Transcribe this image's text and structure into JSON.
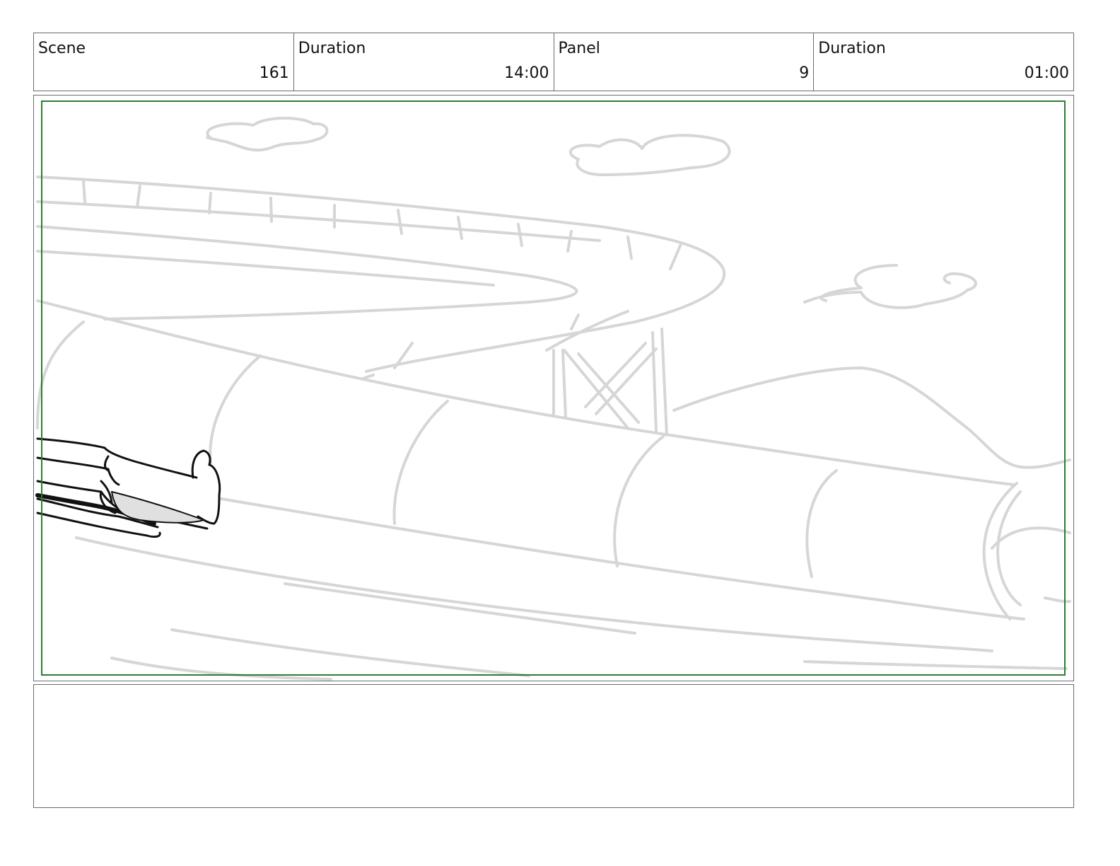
{
  "header": {
    "cells": [
      {
        "label": "Scene",
        "value": "161"
      },
      {
        "label": "Duration",
        "value": "14:00"
      },
      {
        "label": "Panel",
        "value": "9"
      },
      {
        "label": "Duration",
        "value": "01:00"
      }
    ]
  },
  "panel": {
    "safe_frame_color": "#2e7d32",
    "sketch_color": "#d6d6d6",
    "ink_color": "#111111"
  },
  "notes": {
    "text": ""
  }
}
